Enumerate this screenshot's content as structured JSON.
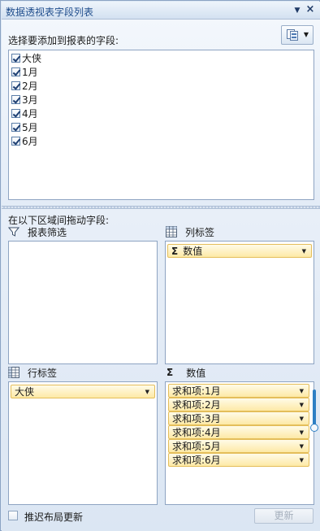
{
  "panel": {
    "title": "数据透视表字段列表",
    "dropdown_icon": "triangle-down-icon",
    "close_icon": "close-icon"
  },
  "field_chooser": {
    "label": "选择要添加到报表的字段:",
    "layout_icon": "field-layout-icon",
    "fields": [
      {
        "label": "大侠",
        "checked": true
      },
      {
        "label": "1月",
        "checked": true
      },
      {
        "label": "2月",
        "checked": true
      },
      {
        "label": "3月",
        "checked": true
      },
      {
        "label": "4月",
        "checked": true
      },
      {
        "label": "5月",
        "checked": true
      },
      {
        "label": "6月",
        "checked": true
      }
    ]
  },
  "areas": {
    "drag_label": "在以下区域间拖动字段:",
    "report_filter": {
      "label": "报表筛选",
      "icon": "filter-icon",
      "items": []
    },
    "column_labels": {
      "label": "列标签",
      "icon": "grid-icon",
      "items": [
        {
          "label": "数值",
          "sigma": "Σ"
        }
      ]
    },
    "row_labels": {
      "label": "行标签",
      "icon": "grid-icon",
      "items": [
        {
          "label": "大侠"
        }
      ]
    },
    "values": {
      "label": "数值",
      "sigma": "Σ",
      "items": [
        {
          "label": "求和项:1月"
        },
        {
          "label": "求和项:2月"
        },
        {
          "label": "求和项:3月"
        },
        {
          "label": "求和项:4月"
        },
        {
          "label": "求和项:5月"
        },
        {
          "label": "求和项:6月"
        }
      ]
    }
  },
  "footer": {
    "defer_label": "推迟布局更新",
    "defer_checked": false,
    "update_button": "更新",
    "update_enabled": false
  },
  "colors": {
    "title_text": "#1f4d8c",
    "pill_fill": "#fde9a6",
    "pill_border": "#e4be5a",
    "scroll_accent": "#2d7fc4"
  }
}
